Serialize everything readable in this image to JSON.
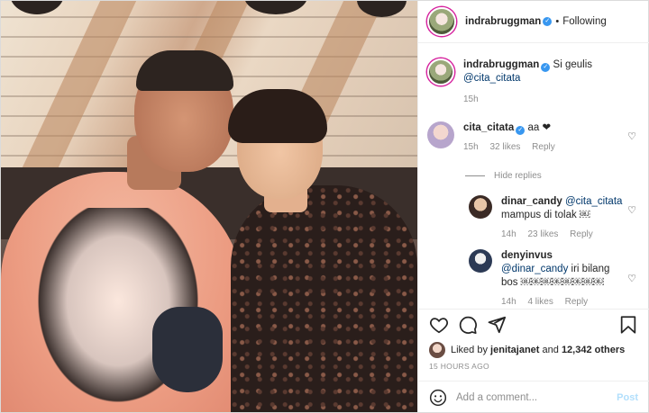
{
  "header": {
    "username": "indrabruggman",
    "separator": "•",
    "follow_status": "Following"
  },
  "caption": {
    "username": "indrabruggman",
    "text": "Si geulis",
    "mention": "@cita_citata",
    "time": "15h"
  },
  "comments": [
    {
      "username": "cita_citata",
      "text": "aa ❤",
      "time": "15h",
      "likes": "32 likes",
      "reply_label": "Reply"
    }
  ],
  "hide_replies_label": "Hide replies",
  "replies": [
    {
      "username": "dinar_candy",
      "mention": "@cita_citata",
      "text": "mampus di tolak ￼",
      "time": "14h",
      "likes": "23 likes",
      "reply_label": "Reply"
    },
    {
      "username": "denyinvus",
      "mention": "@dinar_candy",
      "text": "iri bilang",
      "text2": "bos ￼￼￼￼￼￼￼￼",
      "time": "14h",
      "likes": "4 likes",
      "reply_label": "Reply"
    }
  ],
  "likes_line": {
    "prefix": "Liked by",
    "user": "jenitajanet",
    "and": "and",
    "count": "12,342 others"
  },
  "post_time": "15 HOURS AGO",
  "add_comment": {
    "placeholder": "Add a comment...",
    "post_label": "Post"
  },
  "icons": [
    "heart-icon",
    "comment-icon",
    "share-icon",
    "bookmark-icon",
    "emoji-icon",
    "verified-icon"
  ],
  "colors": {
    "link": "#00376b",
    "verified": "#3897f0",
    "muted": "#8e8e8e",
    "post_disabled": "#b2dffc"
  }
}
